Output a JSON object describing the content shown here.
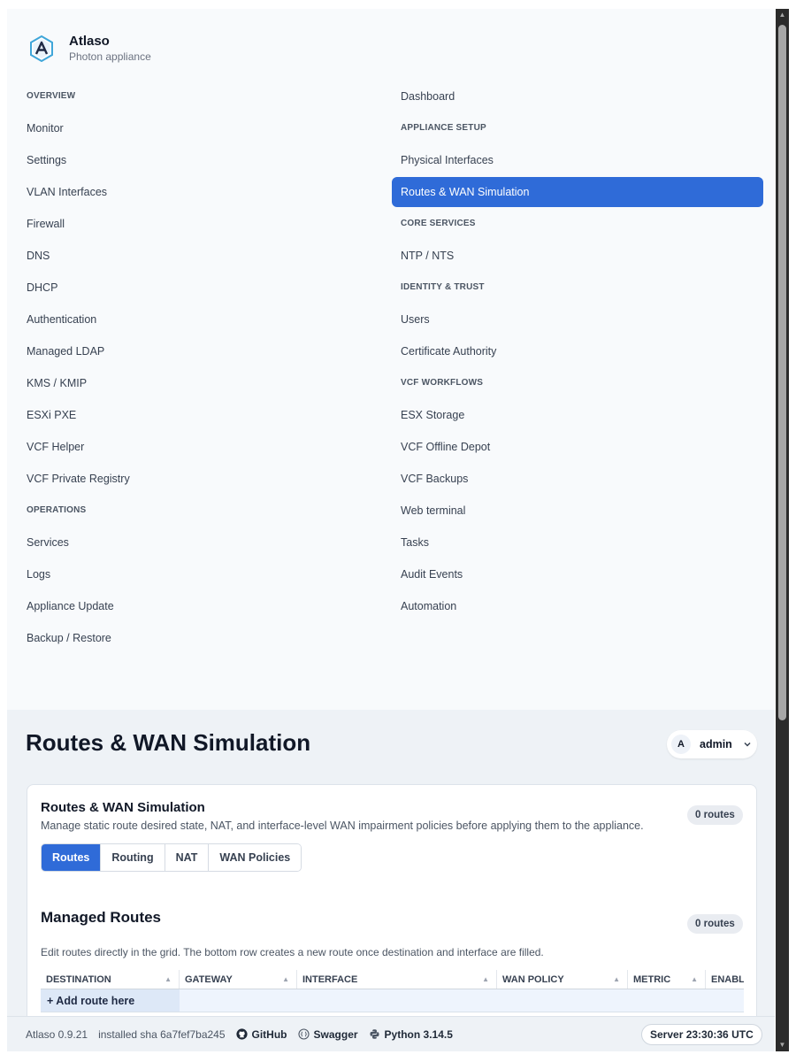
{
  "brand": {
    "name": "Atlaso",
    "subtitle": "Photon appliance"
  },
  "nav": {
    "left": [
      {
        "kind": "section",
        "label": "OVERVIEW"
      },
      {
        "kind": "item",
        "label": "Monitor"
      },
      {
        "kind": "item",
        "label": "Settings"
      },
      {
        "kind": "item",
        "label": "VLAN Interfaces"
      },
      {
        "kind": "item",
        "label": "Firewall"
      },
      {
        "kind": "item",
        "label": "DNS"
      },
      {
        "kind": "item",
        "label": "DHCP"
      },
      {
        "kind": "item",
        "label": "Authentication"
      },
      {
        "kind": "item",
        "label": "Managed LDAP"
      },
      {
        "kind": "item",
        "label": "KMS / KMIP"
      },
      {
        "kind": "item",
        "label": "ESXi PXE"
      },
      {
        "kind": "item",
        "label": "VCF Helper"
      },
      {
        "kind": "item",
        "label": "VCF Private Registry"
      },
      {
        "kind": "section",
        "label": "OPERATIONS"
      },
      {
        "kind": "item",
        "label": "Services"
      },
      {
        "kind": "item",
        "label": "Logs"
      },
      {
        "kind": "item",
        "label": "Appliance Update"
      },
      {
        "kind": "item",
        "label": "Backup / Restore"
      }
    ],
    "right": [
      {
        "kind": "item",
        "label": "Dashboard"
      },
      {
        "kind": "section",
        "label": "APPLIANCE SETUP"
      },
      {
        "kind": "item",
        "label": "Physical Interfaces"
      },
      {
        "kind": "item",
        "label": "Routes & WAN Simulation",
        "active": true
      },
      {
        "kind": "section",
        "label": "CORE SERVICES"
      },
      {
        "kind": "item",
        "label": "NTP / NTS"
      },
      {
        "kind": "section",
        "label": "IDENTITY & TRUST"
      },
      {
        "kind": "item",
        "label": "Users"
      },
      {
        "kind": "item",
        "label": "Certificate Authority"
      },
      {
        "kind": "section",
        "label": "VCF WORKFLOWS"
      },
      {
        "kind": "item",
        "label": "ESX Storage"
      },
      {
        "kind": "item",
        "label": "VCF Offline Depot"
      },
      {
        "kind": "item",
        "label": "VCF Backups"
      },
      {
        "kind": "item",
        "label": "Web terminal"
      },
      {
        "kind": "item",
        "label": "Tasks"
      },
      {
        "kind": "item",
        "label": "Audit Events"
      },
      {
        "kind": "item",
        "label": "Automation"
      }
    ]
  },
  "header": {
    "title": "Routes & WAN Simulation"
  },
  "user": {
    "initial": "A",
    "name": "admin"
  },
  "card": {
    "title": "Routes & WAN Simulation",
    "description": "Manage static route desired state, NAT, and interface-level WAN impairment policies before applying them to the appliance.",
    "count_badge": "0 routes",
    "tabs": [
      "Routes",
      "Routing",
      "NAT",
      "WAN Policies"
    ],
    "active_tab": "Routes"
  },
  "managed_routes": {
    "title": "Managed Routes",
    "count_badge": "0 routes",
    "description": "Edit routes directly in the grid. The bottom row creates a new route once destination and interface are filled.",
    "columns": [
      "DESTINATION",
      "GATEWAY",
      "INTERFACE",
      "WAN POLICY",
      "METRIC",
      "ENABL"
    ],
    "add_row_label": "+ Add route here"
  },
  "footer": {
    "version": "Atlaso 0.9.21",
    "sha": "installed sha 6a7fef7ba245",
    "github": "GitHub",
    "swagger": "Swagger",
    "python": "Python 3.14.5",
    "server_time": "Server 23:30:36 UTC"
  }
}
